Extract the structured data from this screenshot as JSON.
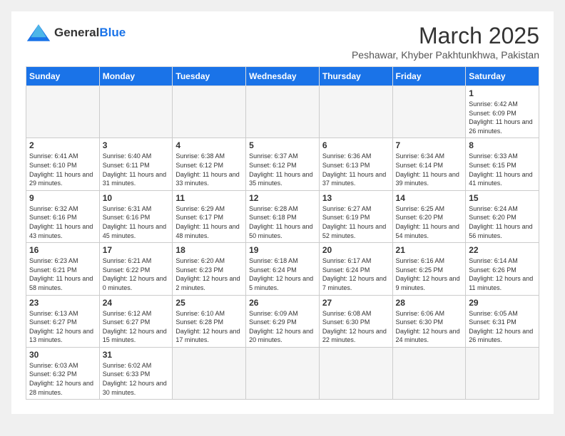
{
  "header": {
    "logo_general": "General",
    "logo_blue": "Blue",
    "month": "March 2025",
    "location": "Peshawar, Khyber Pakhtunkhwa, Pakistan"
  },
  "days_of_week": [
    "Sunday",
    "Monday",
    "Tuesday",
    "Wednesday",
    "Thursday",
    "Friday",
    "Saturday"
  ],
  "weeks": [
    [
      {
        "day": "",
        "info": ""
      },
      {
        "day": "",
        "info": ""
      },
      {
        "day": "",
        "info": ""
      },
      {
        "day": "",
        "info": ""
      },
      {
        "day": "",
        "info": ""
      },
      {
        "day": "",
        "info": ""
      },
      {
        "day": "1",
        "info": "Sunrise: 6:42 AM\nSunset: 6:09 PM\nDaylight: 11 hours and 26 minutes."
      }
    ],
    [
      {
        "day": "2",
        "info": "Sunrise: 6:41 AM\nSunset: 6:10 PM\nDaylight: 11 hours and 29 minutes."
      },
      {
        "day": "3",
        "info": "Sunrise: 6:40 AM\nSunset: 6:11 PM\nDaylight: 11 hours and 31 minutes."
      },
      {
        "day": "4",
        "info": "Sunrise: 6:38 AM\nSunset: 6:12 PM\nDaylight: 11 hours and 33 minutes."
      },
      {
        "day": "5",
        "info": "Sunrise: 6:37 AM\nSunset: 6:12 PM\nDaylight: 11 hours and 35 minutes."
      },
      {
        "day": "6",
        "info": "Sunrise: 6:36 AM\nSunset: 6:13 PM\nDaylight: 11 hours and 37 minutes."
      },
      {
        "day": "7",
        "info": "Sunrise: 6:34 AM\nSunset: 6:14 PM\nDaylight: 11 hours and 39 minutes."
      },
      {
        "day": "8",
        "info": "Sunrise: 6:33 AM\nSunset: 6:15 PM\nDaylight: 11 hours and 41 minutes."
      }
    ],
    [
      {
        "day": "9",
        "info": "Sunrise: 6:32 AM\nSunset: 6:16 PM\nDaylight: 11 hours and 43 minutes."
      },
      {
        "day": "10",
        "info": "Sunrise: 6:31 AM\nSunset: 6:16 PM\nDaylight: 11 hours and 45 minutes."
      },
      {
        "day": "11",
        "info": "Sunrise: 6:29 AM\nSunset: 6:17 PM\nDaylight: 11 hours and 48 minutes."
      },
      {
        "day": "12",
        "info": "Sunrise: 6:28 AM\nSunset: 6:18 PM\nDaylight: 11 hours and 50 minutes."
      },
      {
        "day": "13",
        "info": "Sunrise: 6:27 AM\nSunset: 6:19 PM\nDaylight: 11 hours and 52 minutes."
      },
      {
        "day": "14",
        "info": "Sunrise: 6:25 AM\nSunset: 6:20 PM\nDaylight: 11 hours and 54 minutes."
      },
      {
        "day": "15",
        "info": "Sunrise: 6:24 AM\nSunset: 6:20 PM\nDaylight: 11 hours and 56 minutes."
      }
    ],
    [
      {
        "day": "16",
        "info": "Sunrise: 6:23 AM\nSunset: 6:21 PM\nDaylight: 11 hours and 58 minutes."
      },
      {
        "day": "17",
        "info": "Sunrise: 6:21 AM\nSunset: 6:22 PM\nDaylight: 12 hours and 0 minutes."
      },
      {
        "day": "18",
        "info": "Sunrise: 6:20 AM\nSunset: 6:23 PM\nDaylight: 12 hours and 2 minutes."
      },
      {
        "day": "19",
        "info": "Sunrise: 6:18 AM\nSunset: 6:24 PM\nDaylight: 12 hours and 5 minutes."
      },
      {
        "day": "20",
        "info": "Sunrise: 6:17 AM\nSunset: 6:24 PM\nDaylight: 12 hours and 7 minutes."
      },
      {
        "day": "21",
        "info": "Sunrise: 6:16 AM\nSunset: 6:25 PM\nDaylight: 12 hours and 9 minutes."
      },
      {
        "day": "22",
        "info": "Sunrise: 6:14 AM\nSunset: 6:26 PM\nDaylight: 12 hours and 11 minutes."
      }
    ],
    [
      {
        "day": "23",
        "info": "Sunrise: 6:13 AM\nSunset: 6:27 PM\nDaylight: 12 hours and 13 minutes."
      },
      {
        "day": "24",
        "info": "Sunrise: 6:12 AM\nSunset: 6:27 PM\nDaylight: 12 hours and 15 minutes."
      },
      {
        "day": "25",
        "info": "Sunrise: 6:10 AM\nSunset: 6:28 PM\nDaylight: 12 hours and 17 minutes."
      },
      {
        "day": "26",
        "info": "Sunrise: 6:09 AM\nSunset: 6:29 PM\nDaylight: 12 hours and 20 minutes."
      },
      {
        "day": "27",
        "info": "Sunrise: 6:08 AM\nSunset: 6:30 PM\nDaylight: 12 hours and 22 minutes."
      },
      {
        "day": "28",
        "info": "Sunrise: 6:06 AM\nSunset: 6:30 PM\nDaylight: 12 hours and 24 minutes."
      },
      {
        "day": "29",
        "info": "Sunrise: 6:05 AM\nSunset: 6:31 PM\nDaylight: 12 hours and 26 minutes."
      }
    ],
    [
      {
        "day": "30",
        "info": "Sunrise: 6:03 AM\nSunset: 6:32 PM\nDaylight: 12 hours and 28 minutes."
      },
      {
        "day": "31",
        "info": "Sunrise: 6:02 AM\nSunset: 6:33 PM\nDaylight: 12 hours and 30 minutes."
      },
      {
        "day": "",
        "info": ""
      },
      {
        "day": "",
        "info": ""
      },
      {
        "day": "",
        "info": ""
      },
      {
        "day": "",
        "info": ""
      },
      {
        "day": "",
        "info": ""
      }
    ]
  ]
}
